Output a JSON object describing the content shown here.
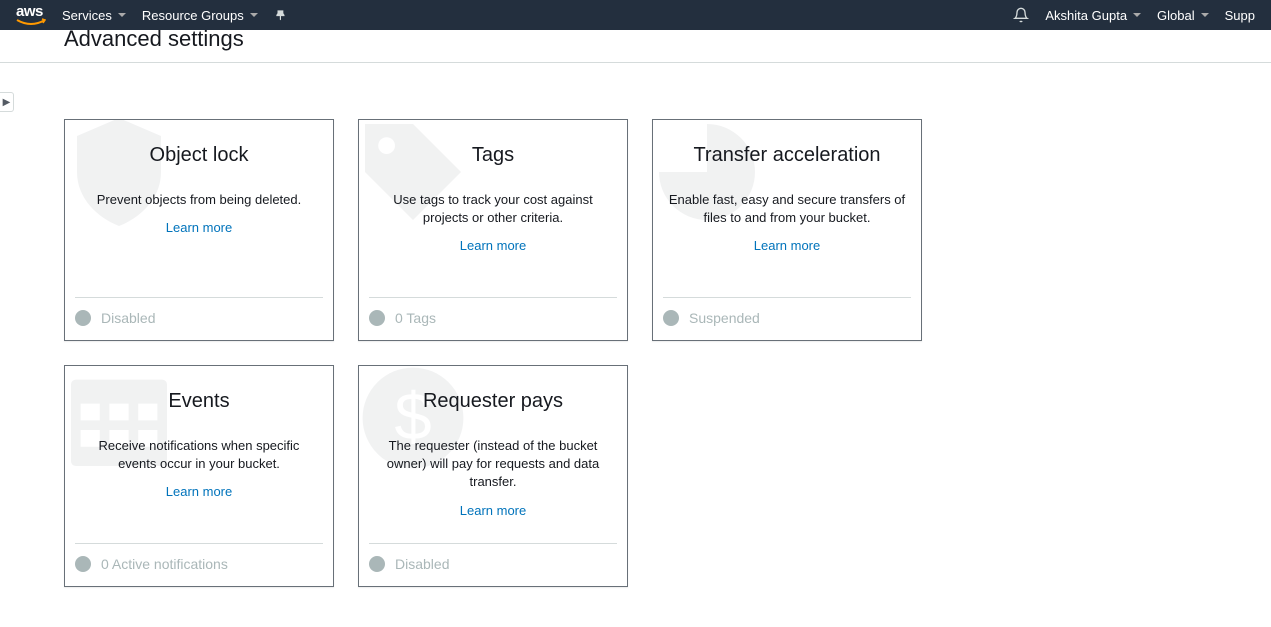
{
  "nav": {
    "logo": "aws",
    "services": "Services",
    "resource_groups": "Resource Groups",
    "user": "Akshita Gupta",
    "region": "Global",
    "support": "Supp"
  },
  "page": {
    "title": "Advanced settings"
  },
  "cards": [
    {
      "title": "Object lock",
      "desc": "Prevent objects from being deleted.",
      "learn": "Learn more",
      "status": "Disabled",
      "icon": "shield-icon"
    },
    {
      "title": "Tags",
      "desc": "Use tags to track your cost against projects or other criteria.",
      "learn": "Learn more",
      "status": "0 Tags",
      "icon": "tag-icon"
    },
    {
      "title": "Transfer acceleration",
      "desc": "Enable fast, easy and secure transfers of files to and from your bucket.",
      "learn": "Learn more",
      "status": "Suspended",
      "icon": "speed-icon"
    },
    {
      "title": "Events",
      "desc": "Receive notifications when specific events occur in your bucket.",
      "learn": "Learn more",
      "status": "0 Active notifications",
      "icon": "calendar-icon"
    },
    {
      "title": "Requester pays",
      "desc": "The requester (instead of the bucket owner) will pay for requests and data transfer.",
      "learn": "Learn more",
      "status": "Disabled",
      "icon": "dollar-icon"
    }
  ]
}
